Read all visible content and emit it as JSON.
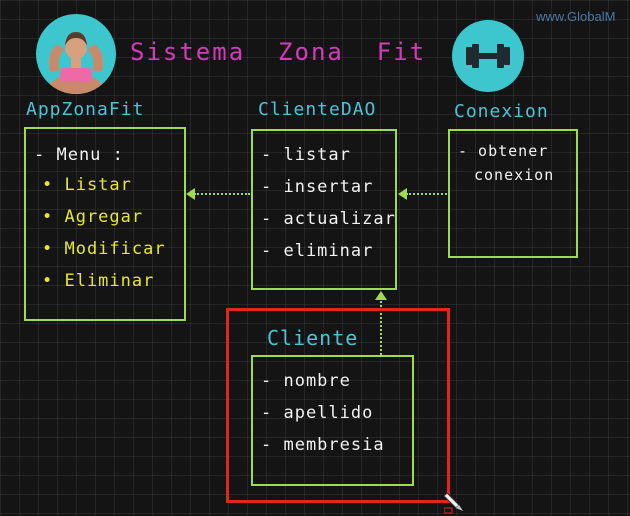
{
  "header": {
    "title": "Sistema  Zona  Fit",
    "watermark": "www.GlobalM"
  },
  "classes": {
    "app": {
      "title": "AppZonaFit",
      "lines": [
        "- Menu :",
        "• Listar",
        "• Agregar",
        "• Modificar",
        "• Eliminar"
      ]
    },
    "dao": {
      "title": "ClienteDAO",
      "lines": [
        "- listar",
        "- insertar",
        "- actualizar",
        "- eliminar"
      ]
    },
    "conexion": {
      "title": "Conexion",
      "lines": [
        "- obtener",
        "conexion"
      ]
    },
    "cliente": {
      "title": "Cliente",
      "lines": [
        "- nombre",
        "- apellido",
        "- membresia"
      ]
    }
  },
  "colors": {
    "background": "#141414",
    "box_border": "#9fdc4d",
    "class_title": "#4cc3d9",
    "menu_items": "#e6e82e",
    "highlight": "#e52420",
    "title": "#d23bbd"
  }
}
